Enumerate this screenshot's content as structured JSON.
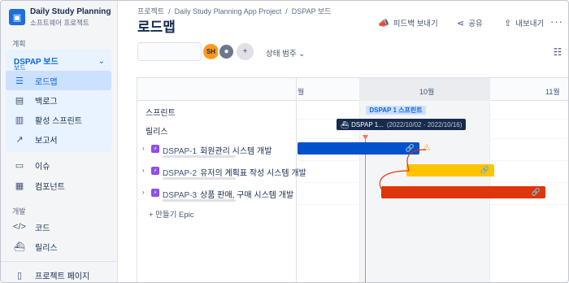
{
  "sidebar": {
    "project_name": "Daily Study Planning A...",
    "project_type": "소프트웨어 프로젝트",
    "section_planning": "계획",
    "board_title": "DSPAP 보드",
    "board_sub": "보드",
    "nav": [
      {
        "label": "로드맵",
        "icon": "roadmap-icon"
      },
      {
        "label": "백로그",
        "icon": "backlog-icon"
      },
      {
        "label": "활성 스프린트",
        "icon": "sprint-board-icon"
      },
      {
        "label": "보고서",
        "icon": "reports-icon"
      },
      {
        "label": "이슈",
        "icon": "issues-icon"
      },
      {
        "label": "컴포넌트",
        "icon": "components-icon"
      }
    ],
    "section_dev": "개발",
    "dev_nav": [
      {
        "label": "코드",
        "icon": "code-icon"
      },
      {
        "label": "릴리스",
        "icon": "releases-icon"
      }
    ],
    "project_pages": "프로젝트 페이지"
  },
  "header": {
    "breadcrumb": [
      "프로젝트",
      "Daily Study Planning App Project",
      "DSPAP 보드"
    ],
    "title": "로드맵",
    "feedback": "피드백 보내기",
    "share": "공유",
    "export": "내보내기",
    "more": "···"
  },
  "toolbar": {
    "avatar_initials": "SH",
    "status_filter": "상태 범주",
    "status_chevron": "⌄"
  },
  "roadmap": {
    "row_sprint": "스프린트",
    "row_release": "릴리스",
    "months": [
      "월",
      "10월",
      "11월"
    ],
    "sprint_chip": "DSPAP 1 스프린트",
    "release_name": "DSPAP 1...",
    "release_dates": "(2022/10/02 - 2022/10/16)",
    "epics": [
      {
        "key": "DSPAP-1",
        "title": "회원관리 시스템 개발",
        "color": "#0052cc"
      },
      {
        "key": "DSPAP-2",
        "title": "유저의 계획표 작성 시스템 개발",
        "color": "#ffc400"
      },
      {
        "key": "DSPAP-3",
        "title": "상품 판매, 구매 시스템 개발",
        "color": "#de350b"
      }
    ],
    "create_epic": "+ 만들기 Epic"
  }
}
